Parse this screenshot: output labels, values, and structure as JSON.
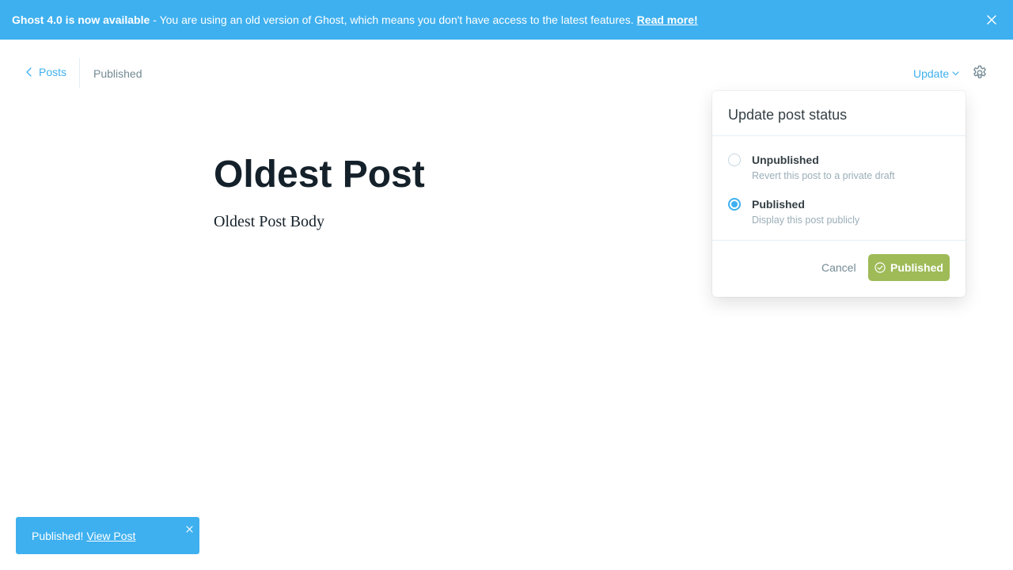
{
  "banner": {
    "headline": "Ghost 4.0 is now available",
    "message": "- You are using an old version of Ghost, which means you don't have access to the latest features.",
    "link_label": "Read more!",
    "close_icon": "close-icon"
  },
  "header": {
    "back_label": "Posts",
    "status": "Published",
    "update_label": "Update",
    "settings_icon": "gear-icon"
  },
  "post": {
    "title": "Oldest Post",
    "body": "Oldest Post Body"
  },
  "popover": {
    "title": "Update post status",
    "options": [
      {
        "label": "Unpublished",
        "description": "Revert this post to a private draft",
        "selected": false
      },
      {
        "label": "Published",
        "description": "Display this post publicly",
        "selected": true
      }
    ],
    "cancel_label": "Cancel",
    "confirm_label": "Published"
  },
  "toast": {
    "message": "Published!",
    "link_label": "View Post"
  },
  "colors": {
    "accent": "#3eb0ef",
    "success": "#9fbb58",
    "text": "#343f44",
    "muted": "#738a94"
  }
}
